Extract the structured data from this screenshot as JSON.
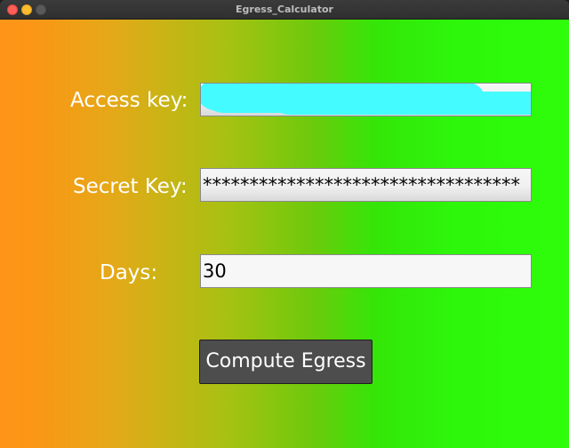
{
  "window": {
    "title": "Egress_Calculator"
  },
  "form": {
    "access_key": {
      "label": "Access key:",
      "value_redacted": true
    },
    "secret_key": {
      "label": "Secret Key:",
      "value": "**********************************"
    },
    "days": {
      "label": "Days:",
      "value": "30"
    },
    "compute_button_label": "Compute Egress"
  },
  "colors": {
    "gradient_left": "#ff9418",
    "gradient_mid": "#a7c112",
    "gradient_right": "#2efd0b",
    "redaction": "#44fcff",
    "button_bg": "#4d4d4d"
  }
}
